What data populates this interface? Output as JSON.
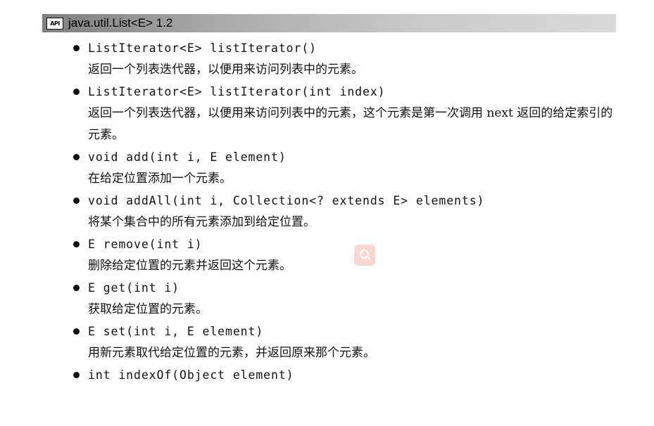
{
  "header": {
    "badge": "API",
    "title": "java.util.List<E> 1.2"
  },
  "entries": [
    {
      "signature": "ListIterator<E> listIterator()",
      "description": "返回一个列表迭代器，以便用来访问列表中的元素。"
    },
    {
      "signature": "ListIterator<E> listIterator(int index)",
      "description": "返回一个列表迭代器，以便用来访问列表中的元素，这个元素是第一次调用 next 返回的给定索引的元素。"
    },
    {
      "signature": "void add(int i, E element)",
      "description": "在给定位置添加一个元素。"
    },
    {
      "signature": "void addAll(int i, Collection<? extends E> elements)",
      "description": "将某个集合中的所有元素添加到给定位置。"
    },
    {
      "signature": "E remove(int i)",
      "description": "删除给定位置的元素并返回这个元素。"
    },
    {
      "signature": "E get(int i)",
      "description": "获取给定位置的元素。"
    },
    {
      "signature": "E set(int i, E element)",
      "description": "用新元素取代给定位置的元素，并返回原来那个元素。"
    },
    {
      "signature": "int indexOf(Object element)",
      "description": ""
    }
  ],
  "icons": {
    "watermark": "search-icon"
  }
}
